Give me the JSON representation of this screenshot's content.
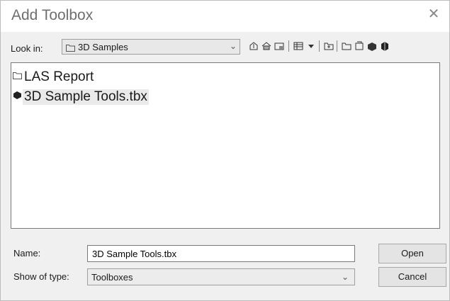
{
  "window": {
    "title": "Add Toolbox",
    "close_icon": "close-icon"
  },
  "lookin": {
    "label": "Look in:",
    "value": "3D Samples",
    "folder_icon": "folder-icon",
    "arrow_icon": "chevron-down-icon"
  },
  "toolbar": {
    "icons": [
      "up-one-level-icon",
      "home-folder-icon",
      "connect-folder-icon",
      "view-list-icon",
      "view-menu-dropdown-icon",
      "new-folder-icon",
      "new-file-icon",
      "new-toolbox-icon",
      "toolbox-icon",
      "geodatabase-icon"
    ]
  },
  "files": [
    {
      "label": "LAS Report",
      "icon": "folder-icon",
      "selected": false
    },
    {
      "label": "3D Sample Tools.tbx",
      "icon": "toolbox-icon",
      "selected": true
    }
  ],
  "name": {
    "label": "Name:",
    "value": "3D Sample Tools.tbx"
  },
  "type": {
    "label": "Show of type:",
    "value": "Toolboxes"
  },
  "buttons": {
    "open": "Open",
    "cancel": "Cancel"
  },
  "colors": {
    "background": "#f0f0f0",
    "selection": "#eaeaea",
    "title": "#6f6f6f"
  }
}
